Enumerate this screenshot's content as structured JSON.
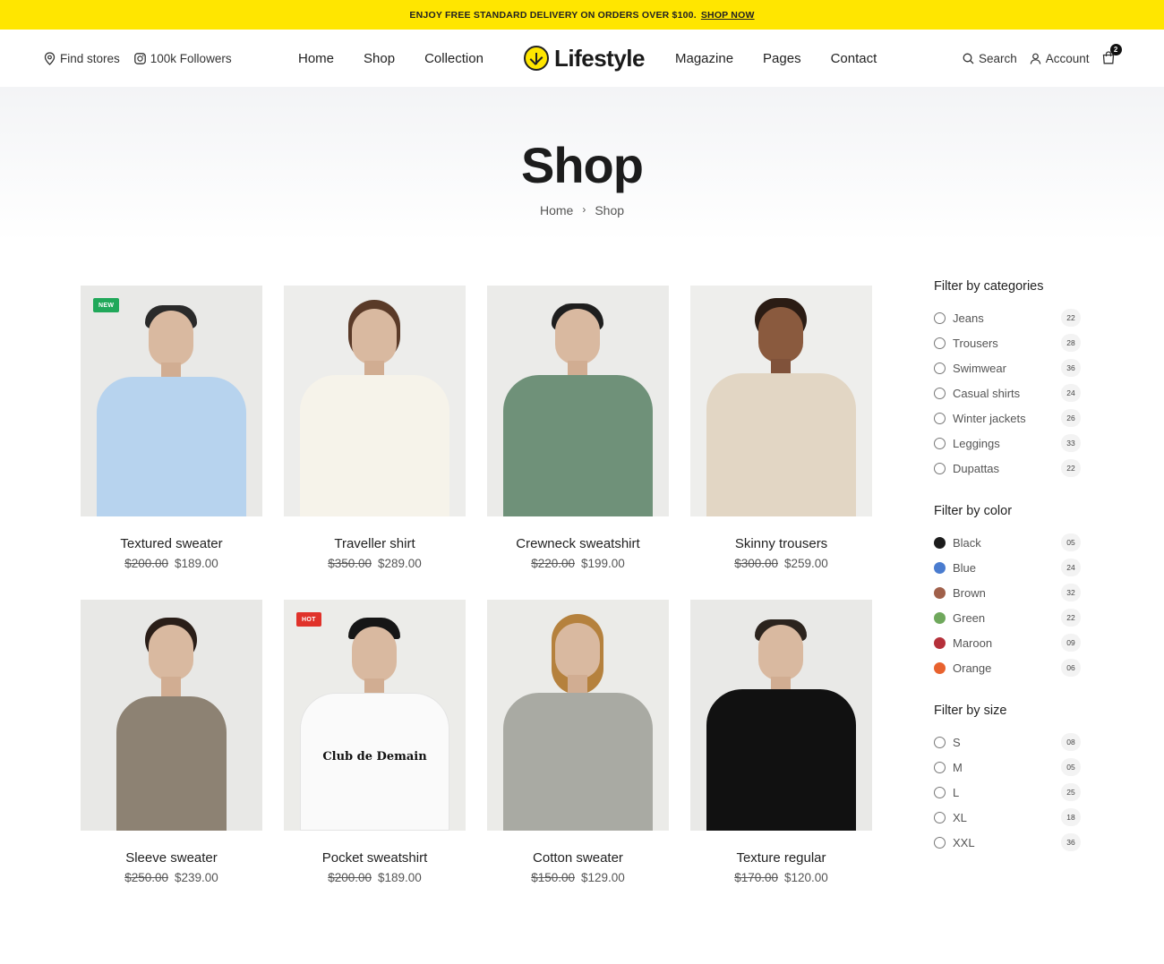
{
  "announcement": {
    "text": "ENJOY FREE STANDARD DELIVERY ON ORDERS OVER $100.",
    "link": "SHOP NOW"
  },
  "header": {
    "find_stores": "Find stores",
    "followers": "100k Followers",
    "nav_left": [
      "Home",
      "Shop",
      "Collection"
    ],
    "logo": "Lifestyle",
    "nav_right": [
      "Magazine",
      "Pages",
      "Contact"
    ],
    "search": "Search",
    "account": "Account",
    "cart_count": "2"
  },
  "hero": {
    "title": "Shop",
    "breadcrumb": [
      "Home",
      "Shop"
    ]
  },
  "products": [
    {
      "name": "Textured sweater",
      "old_price": "$200.00",
      "price": "$189.00",
      "badge": "NEW",
      "badge_type": "new"
    },
    {
      "name": "Traveller shirt",
      "old_price": "$350.00",
      "price": "$289.00"
    },
    {
      "name": "Crewneck sweatshirt",
      "old_price": "$220.00",
      "price": "$199.00"
    },
    {
      "name": "Skinny trousers",
      "old_price": "$300.00",
      "price": "$259.00"
    },
    {
      "name": "Sleeve sweater",
      "old_price": "$250.00",
      "price": "$239.00"
    },
    {
      "name": "Pocket sweatshirt",
      "old_price": "$200.00",
      "price": "$189.00",
      "badge": "HOT",
      "badge_type": "hot",
      "print_text": "Club de Demain"
    },
    {
      "name": "Cotton sweater",
      "old_price": "$150.00",
      "price": "$129.00"
    },
    {
      "name": "Texture regular",
      "old_price": "$170.00",
      "price": "$120.00"
    }
  ],
  "filters": {
    "categories": {
      "title": "Filter by categories",
      "items": [
        {
          "label": "Jeans",
          "count": "22"
        },
        {
          "label": "Trousers",
          "count": "28"
        },
        {
          "label": "Swimwear",
          "count": "36"
        },
        {
          "label": "Casual shirts",
          "count": "24"
        },
        {
          "label": "Winter jackets",
          "count": "26"
        },
        {
          "label": "Leggings",
          "count": "33"
        },
        {
          "label": "Dupattas",
          "count": "22"
        }
      ]
    },
    "color": {
      "title": "Filter by color",
      "items": [
        {
          "label": "Black",
          "count": "05",
          "color": "#1c1c1c"
        },
        {
          "label": "Blue",
          "count": "24",
          "color": "#4a7ccf"
        },
        {
          "label": "Brown",
          "count": "32",
          "color": "#a0604a"
        },
        {
          "label": "Green",
          "count": "22",
          "color": "#6fa85c"
        },
        {
          "label": "Maroon",
          "count": "09",
          "color": "#b5303a"
        },
        {
          "label": "Orange",
          "count": "06",
          "color": "#e8622e"
        }
      ]
    },
    "size": {
      "title": "Filter by size",
      "items": [
        {
          "label": "S",
          "count": "08"
        },
        {
          "label": "M",
          "count": "05"
        },
        {
          "label": "L",
          "count": "25"
        },
        {
          "label": "XL",
          "count": "18"
        },
        {
          "label": "XXL",
          "count": "36"
        }
      ]
    }
  },
  "colors": {
    "accent": "#ffe600",
    "badge_new": "#21a85a",
    "badge_hot": "#e0322a"
  }
}
